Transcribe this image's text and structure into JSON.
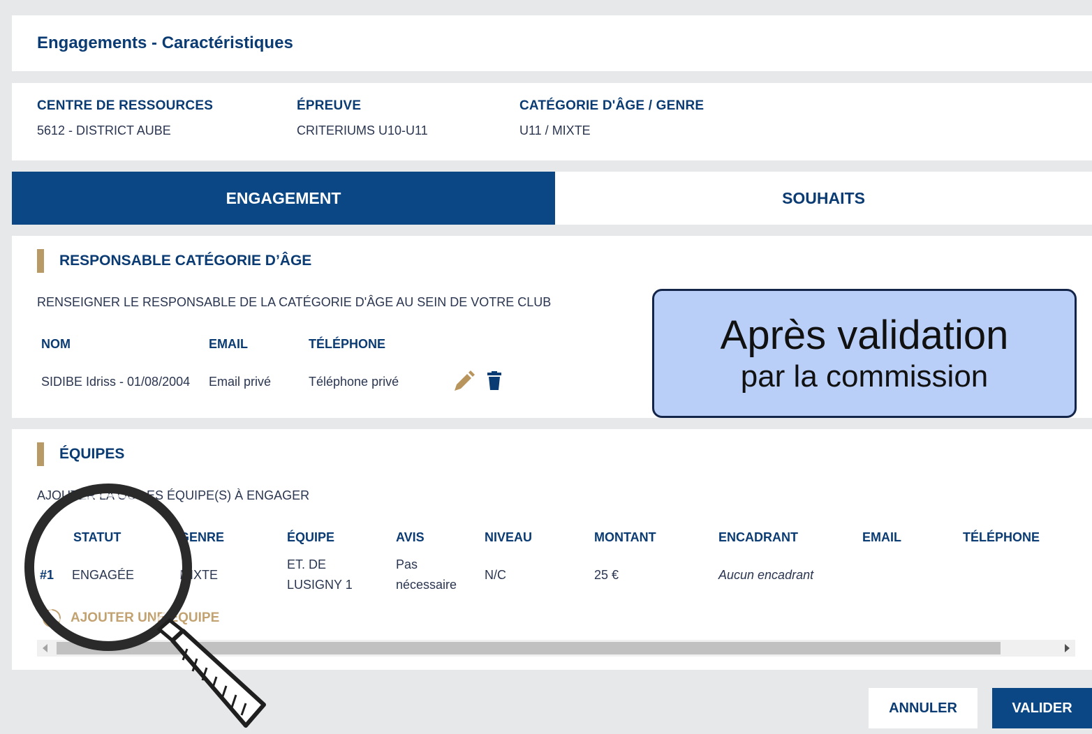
{
  "page_title": "Engagements - Caractéristiques",
  "info": [
    {
      "label": "CENTRE DE RESSOURCES",
      "value": "5612 - DISTRICT AUBE"
    },
    {
      "label": "ÉPREUVE",
      "value": "CRITERIUMS U10-U11"
    },
    {
      "label": "CATÉGORIE D'ÂGE / GENRE",
      "value": "U11 / MIXTE"
    }
  ],
  "tabs": {
    "engagement": "ENGAGEMENT",
    "souhaits": "SOUHAITS",
    "active": "ENGAGEMENT"
  },
  "responsable": {
    "title": "RESPONSABLE CATÉGORIE D’ÂGE",
    "subtitle": "RENSEIGNER LE RESPONSABLE DE LA CATÉGORIE D'ÂGE AU SEIN DE VOTRE CLUB",
    "headers": {
      "nom": "NOM",
      "email": "EMAIL",
      "telephone": "TÉLÉPHONE"
    },
    "row": {
      "nom": "SIDIBE Idriss - 01/08/2004",
      "email": "Email privé",
      "telephone": "Téléphone privé"
    }
  },
  "equipes": {
    "title": "ÉQUIPES",
    "subtitle": "AJOUTER LA OU LES ÉQUIPE(S) À ENGAGER",
    "headers": {
      "statut": "STATUT",
      "genre": "GENRE",
      "equipe": "ÉQUIPE",
      "avis": "AVIS",
      "niveau": "NIVEAU",
      "montant": "MONTANT",
      "encadrant": "ENCADRANT",
      "email": "EMAIL",
      "telephone": "TÉLÉPHONE"
    },
    "rows": [
      {
        "num": "#1",
        "statut": "ENGAGÉE",
        "genre": "MIXTE",
        "equipe_line1": "ET. DE",
        "equipe_line2": "LUSIGNY 1",
        "avis_line1": "Pas",
        "avis_line2": "nécessaire",
        "niveau": "N/C",
        "montant": "25 €",
        "encadrant": "Aucun encadrant"
      }
    ],
    "add_label": "AJOUTER UNE ÉQUIPE"
  },
  "buttons": {
    "annuler": "ANNULER",
    "valider": "VALIDER"
  },
  "callout": {
    "line1": "Après validation",
    "line2": "par la commission"
  },
  "colors": {
    "navy": "#0b4785",
    "gold": "#b89a67",
    "callout_bg": "#b9cff8",
    "page_bg": "#e7e8ea"
  }
}
